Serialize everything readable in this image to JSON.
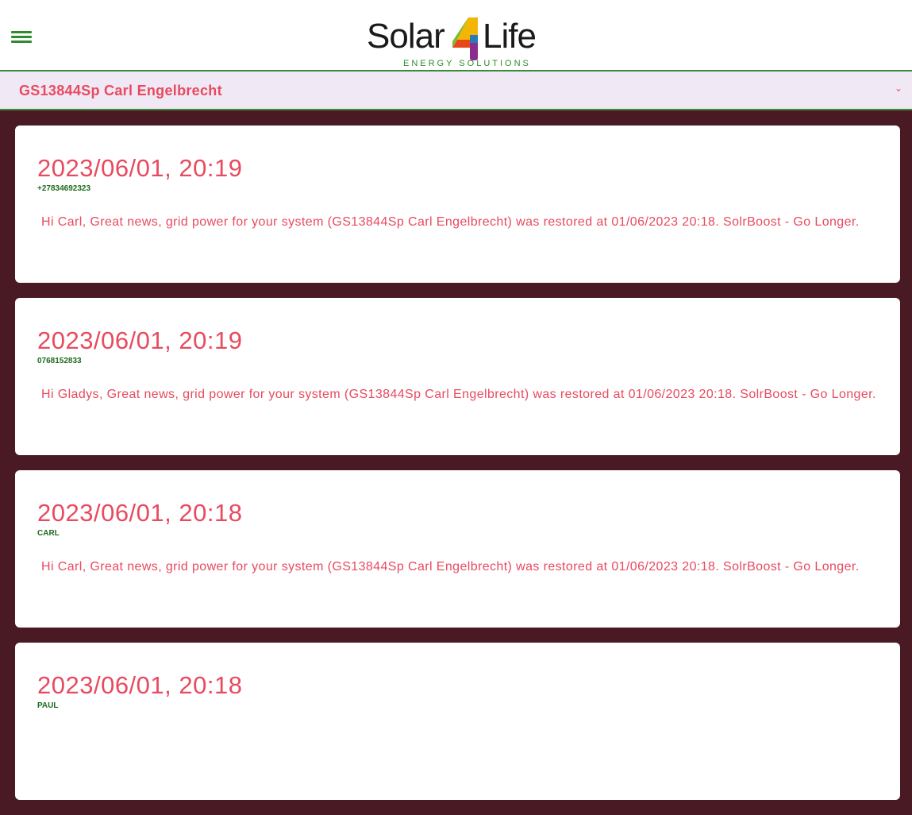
{
  "header": {
    "menu_icon": "hamburger-menu-icon",
    "logo": {
      "left": "Solar",
      "four": "4",
      "right": "Life",
      "tagline": "ENERGY SOLUTIONS"
    }
  },
  "subheader": {
    "title": "GS13844Sp Carl Engelbrecht"
  },
  "colors": {
    "background": "#4a1a24",
    "accent_green": "#2e8b2e",
    "text_pink": "#e84a5f",
    "subheader_bg": "#f0e8f5"
  },
  "messages": [
    {
      "time": "2023/06/01, 20:19",
      "sender": "+27834692323",
      "text": "Hi Carl, Great news, grid power for your system (GS13844Sp Carl Engelbrecht) was restored at 01/06/2023 20:18. SolrBoost - Go Longer."
    },
    {
      "time": "2023/06/01, 20:19",
      "sender": "0768152833",
      "text": "Hi Gladys, Great news, grid power for your system (GS13844Sp Carl Engelbrecht) was restored at 01/06/2023 20:18. SolrBoost - Go Longer."
    },
    {
      "time": "2023/06/01, 20:18",
      "sender": "CARL",
      "text": "Hi Carl, Great news, grid power for your system (GS13844Sp Carl Engelbrecht) was restored at 01/06/2023 20:18. SolrBoost - Go Longer."
    },
    {
      "time": "2023/06/01, 20:18",
      "sender": "PAUL",
      "text": ""
    }
  ]
}
